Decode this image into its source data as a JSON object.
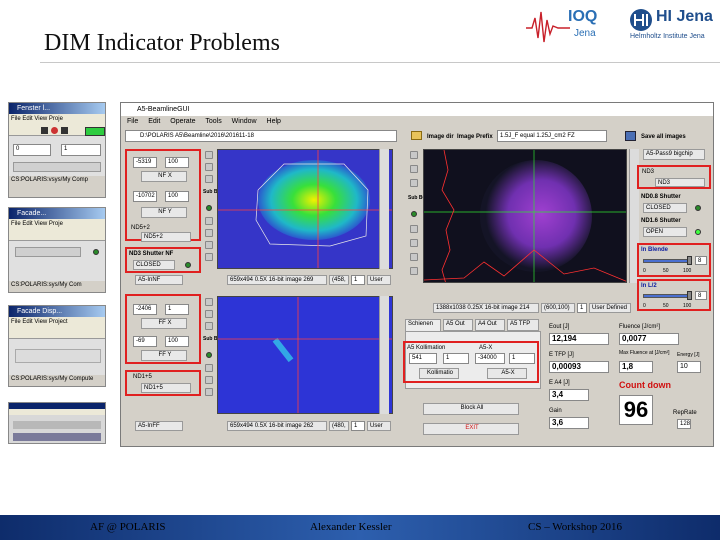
{
  "header": {
    "title": "DIM Indicator Problems",
    "ioq_logo": "IOQ",
    "ioq_sub": "Jena",
    "hij_logo": "HI Jena",
    "hij_sub": "Helmholtz Institute Jena"
  },
  "footer": {
    "left": "AF @ POLARIS",
    "center": "Alexander Kessler",
    "right": "CS – Workshop 2016"
  },
  "mini1": {
    "title": "Fenster l...",
    "menu": "File Edit View Proje",
    "value": "0",
    "value2": "1",
    "path": "CS:POLARIS:vsys/My Comp"
  },
  "mini2": {
    "title": "Facade...",
    "menu": "File Edit View Proje",
    "path": "CS:POLARIS:sys/My Com"
  },
  "mini3": {
    "title": "Facade Disp...",
    "menu": "File Edit View Project",
    "path": "CS:POLARIS:sys/My Compute"
  },
  "gui": {
    "title": "A5-BeamlineGUI",
    "menu": [
      "File",
      "Edit",
      "Operate",
      "Tools",
      "Window",
      "Help"
    ],
    "path": "D:\\POLARIS A5\\Beamline\\2016\\201611-18",
    "image_dir": "Image dir",
    "image_prefix_label": "Image Prefix",
    "image_prefix": "1.5J_F equal 1.25J_cm2 FZ",
    "save_all": "Save all images"
  },
  "left_top": {
    "x_val": "-5319",
    "x_step": "100",
    "nf_x": "NF X",
    "y_val": "-10702",
    "y_step": "100",
    "nf_y": "NF Y",
    "nd5_label": "ND5+2",
    "nd5": "ND5+2",
    "shutter_label": "ND3 Shutter NF",
    "shutter": "CLOSED",
    "sub_bg": "Sub BG",
    "cam": "A5-InNF",
    "img_info": "659x494 0.5X 16-bit image 269",
    "img_coord": "(458,",
    "zoom": "1",
    "user": "User"
  },
  "left_bot": {
    "x_val": "-2406",
    "x_step": "1",
    "ff_x": "FF X",
    "y_val": "-69",
    "y_step": "100",
    "ff_y": "FF Y",
    "nd1_label": "ND1+5",
    "nd1": "ND1+5",
    "sub_bg": "Sub BG",
    "cam": "A5-InFF",
    "img_info": "659x494 0.5X 16-bit image 262",
    "img_coord": "(480,",
    "zoom": "1",
    "user": "User"
  },
  "center_top": {
    "sub_bg": "Sub BG",
    "img_info": "1388x1038 0.25X 16-bit image 214",
    "img_coord": "(600,100)",
    "zoom": "1",
    "user": "User Defined"
  },
  "tabs": [
    "Schienen",
    "A5 Out",
    "A4 Out",
    "A5 TFP"
  ],
  "kollimation": {
    "label": "A5 Kollimation",
    "val": "541",
    "step": "1",
    "name": "Kollimatio",
    "x_label": "A5-X",
    "x_val": "-34000",
    "x_step": "1",
    "x_name": "A5-X"
  },
  "buttons": {
    "block_all": "Block All",
    "exit": "EXIT"
  },
  "right": {
    "cam": "A5-Pass9 bigchip",
    "nd3_label": "ND3",
    "nd3": "ND3",
    "nd08_label": "ND0.8 Shutter",
    "nd08": "CLOSED",
    "nd16_label": "ND1.6 Shutter",
    "nd16": "OPEN",
    "blende_label": "In Blende",
    "blende_val": "8",
    "blende_ticks": [
      "0",
      "50",
      "100"
    ],
    "l2_label": "In L/2",
    "l2_val": "8",
    "l2_ticks": [
      "0",
      "50",
      "100"
    ]
  },
  "readouts": {
    "eout_label": "Eout [J]",
    "eout": "12,194",
    "fluence_label": "Fluence [J/cm²]",
    "fluence": "0,0077",
    "etfp_label": "E TFP [J]",
    "etfp": "0,00093",
    "maxfl_label": "Max Fluence at [J/cm²]",
    "maxfl": "1,8",
    "energy_label": "Energy [J]",
    "energy": "10",
    "ea4_label": "E A4 [J]",
    "ea4": "3,4",
    "countdown_label": "Count down",
    "countdown": "96",
    "gain_label": "Gain",
    "gain": "3,6",
    "reprate_label": "RepRate",
    "reprate": "128"
  },
  "colors": {
    "red_highlight": "#e02020",
    "footer_bar": "#1b4390",
    "title_bar": "#0a246a"
  }
}
